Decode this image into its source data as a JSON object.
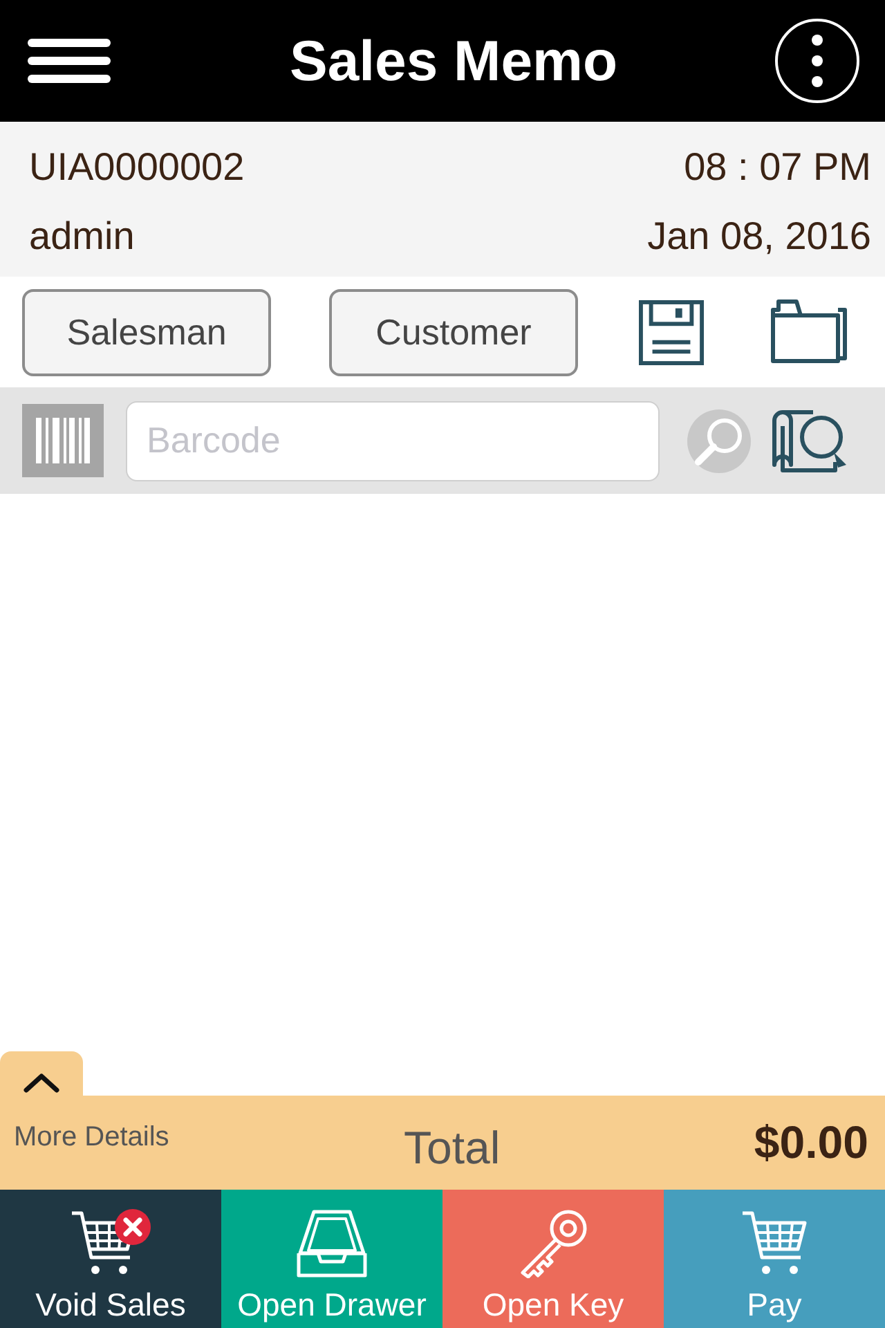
{
  "header": {
    "title": "Sales Memo"
  },
  "memo": {
    "number": "UIA0000002",
    "time": "08 : 07 PM",
    "user": "admin",
    "date": "Jan 08, 2016"
  },
  "selectors": [
    {
      "label": "Salesman"
    },
    {
      "label": "Customer"
    }
  ],
  "barcode_field": {
    "placeholder": "Barcode"
  },
  "summary": {
    "details_label": "More Details",
    "total_label": "Total",
    "total": "$0.00"
  },
  "actions": [
    {
      "kind": "void",
      "label": "Void Sales",
      "color": "#1f3743"
    },
    {
      "kind": "drawer",
      "label": "Open Drawer",
      "color": "#00a88b"
    },
    {
      "kind": "key",
      "label": "Open Key",
      "color": "#ec6b5a"
    },
    {
      "kind": "pay",
      "label": "Pay",
      "color": "#469ebd"
    }
  ]
}
